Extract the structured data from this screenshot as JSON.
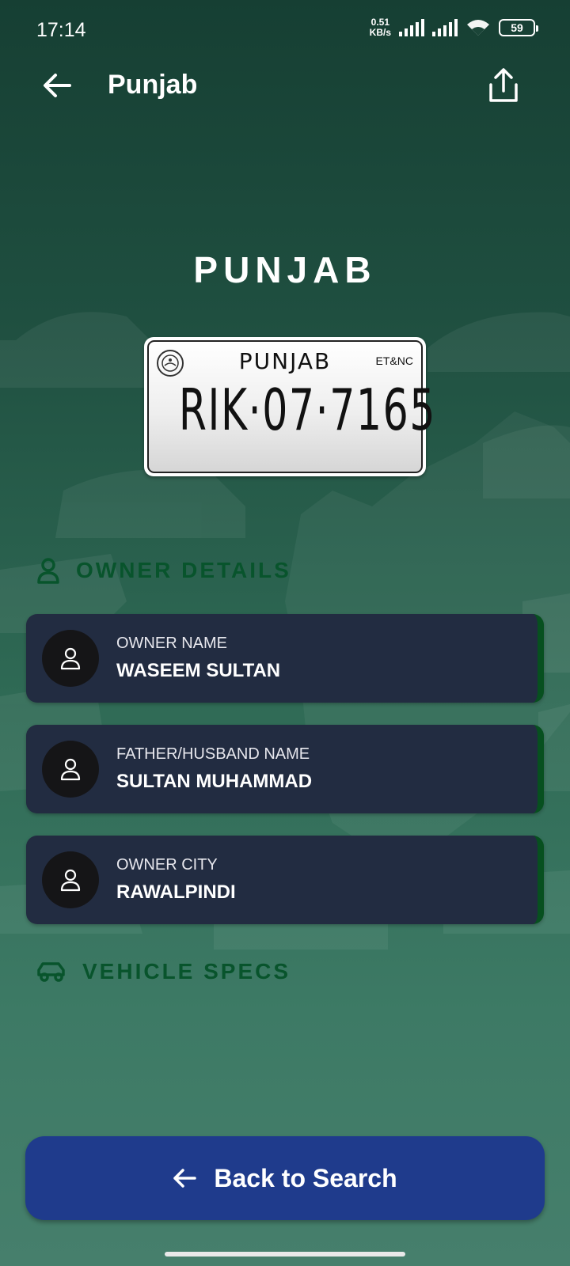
{
  "status_bar": {
    "time": "17:14",
    "net_speed_value": "0.51",
    "net_speed_unit": "KB/s",
    "battery": "59"
  },
  "app_bar": {
    "title": "Punjab",
    "back_icon": "arrow-left-icon",
    "share_icon": "share-icon"
  },
  "hero": {
    "title": "PUNJAB"
  },
  "plate": {
    "province": "PUNJAB",
    "tag": "ET&NC",
    "number": "RIK·07·7165"
  },
  "owner_section": {
    "title": "OWNER DETAILS",
    "icon": "user-icon",
    "cards": [
      {
        "label": "OWNER NAME",
        "value": "WASEEM SULTAN"
      },
      {
        "label": "FATHER/HUSBAND NAME",
        "value": "SULTAN MUHAMMAD"
      },
      {
        "label": "OWNER CITY",
        "value": "RAWALPINDI"
      }
    ]
  },
  "vehicle_section": {
    "title": "VEHICLE SPECS",
    "icon": "car-icon"
  },
  "back_search_button": {
    "label": "Back to Search"
  },
  "colors": {
    "background_top": "#163f33",
    "background_bottom": "#467f6c",
    "section_header": "#08542c",
    "card_background": "#222c41",
    "card_accent": "#07501f",
    "button_background": "#1f3b8c"
  }
}
